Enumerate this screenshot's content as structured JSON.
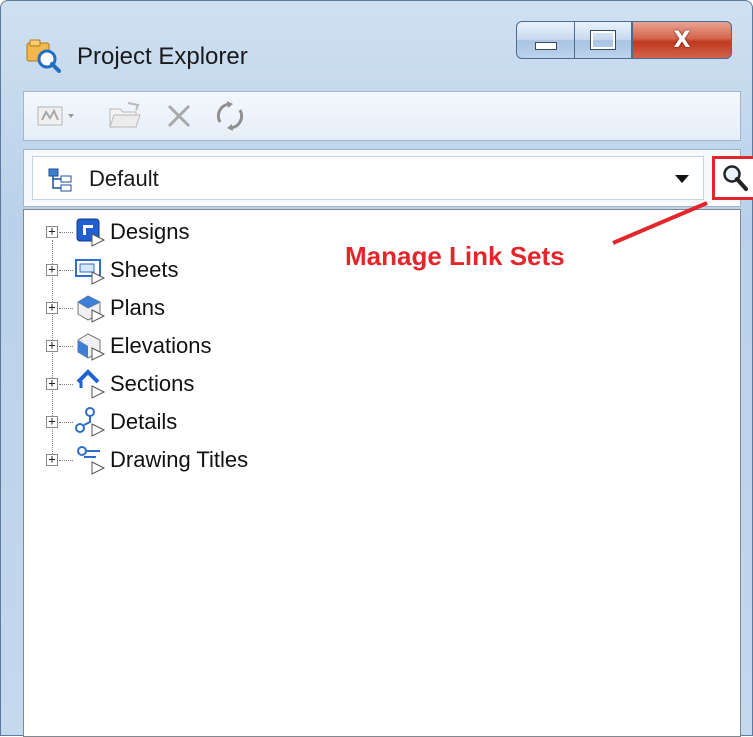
{
  "window": {
    "title": "Project Explorer",
    "controls": {
      "minimize": "minimize",
      "maximize": "maximize",
      "close": "close"
    }
  },
  "toolbar": {
    "icons": [
      "views-dropdown-icon",
      "open-folder-icon",
      "delete-icon",
      "refresh-icon"
    ]
  },
  "link_set": {
    "selected": "Default",
    "manage_button_icon": "magnifier-icon"
  },
  "tree": {
    "items": [
      {
        "label": "Designs",
        "icon": "designs-icon"
      },
      {
        "label": "Sheets",
        "icon": "sheets-icon"
      },
      {
        "label": "Plans",
        "icon": "plans-icon"
      },
      {
        "label": "Elevations",
        "icon": "elevations-icon"
      },
      {
        "label": "Sections",
        "icon": "sections-icon"
      },
      {
        "label": "Details",
        "icon": "details-icon"
      },
      {
        "label": "Drawing Titles",
        "icon": "drawing-titles-icon"
      }
    ]
  },
  "annotation": {
    "text": "Manage Link Sets",
    "color": "#e3262b"
  },
  "colors": {
    "accent_red": "#e3262b",
    "titlebar": "#c4d8ee",
    "close_button": "#c0391f"
  }
}
